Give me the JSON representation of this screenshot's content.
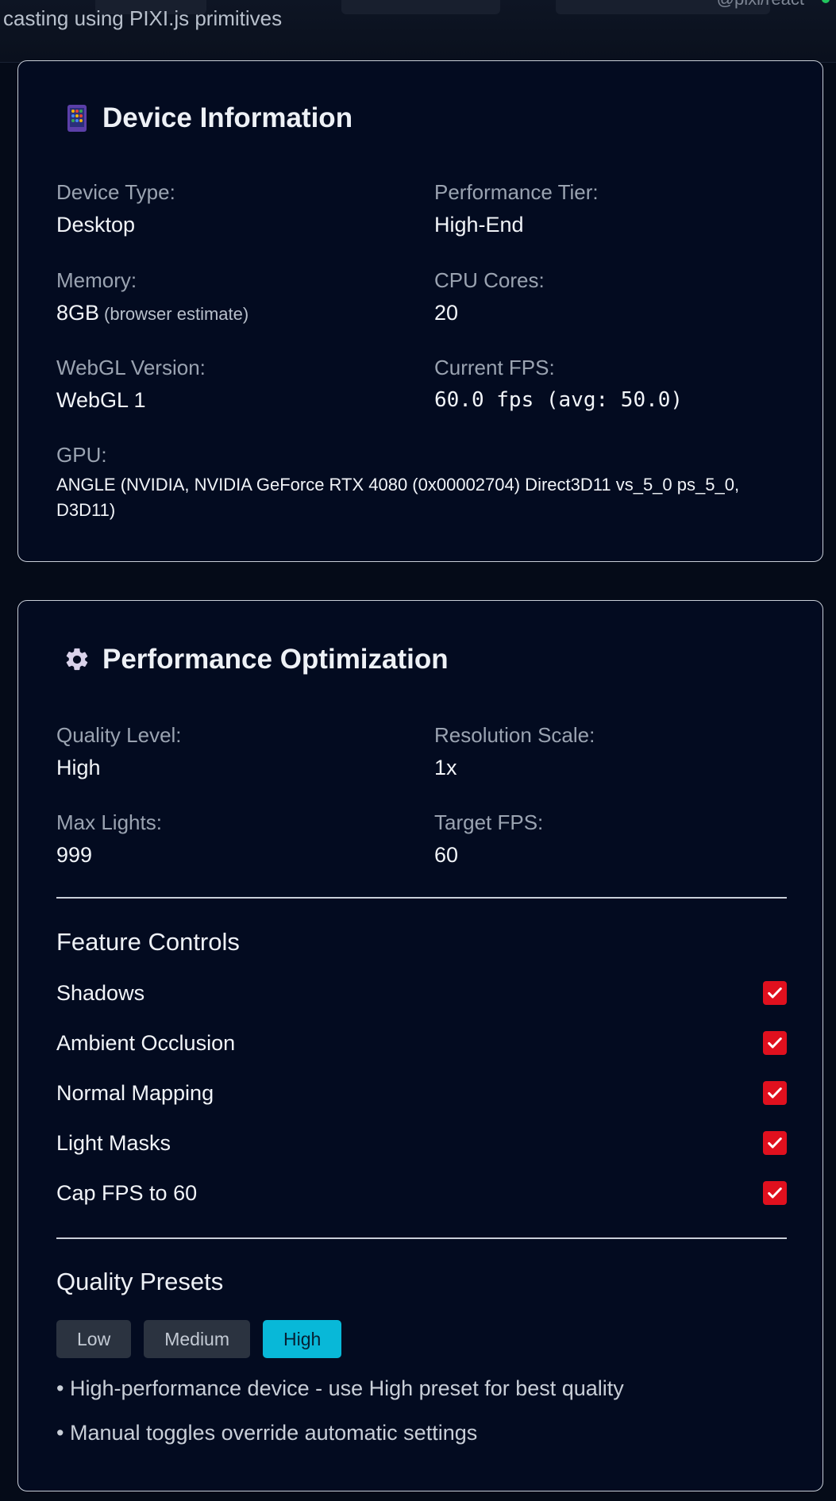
{
  "header": {
    "subtitle": "casting using PIXI.js primitives",
    "handle": "@pixi/react"
  },
  "device_info": {
    "title": "Device Information",
    "icon": "mobile-phone-icon",
    "fields": {
      "device_type": {
        "label": "Device Type:",
        "value": "Desktop"
      },
      "performance_tier": {
        "label": "Performance Tier:",
        "value": "High-End"
      },
      "memory": {
        "label": "Memory:",
        "value": "8GB",
        "note": "(browser estimate)"
      },
      "cpu_cores": {
        "label": "CPU Cores:",
        "value": "20"
      },
      "webgl_version": {
        "label": "WebGL Version:",
        "value": "WebGL 1"
      },
      "current_fps": {
        "label": "Current FPS:",
        "value": "60.0 fps (avg: 50.0)"
      },
      "gpu": {
        "label": "GPU:",
        "value": "ANGLE (NVIDIA, NVIDIA GeForce RTX 4080 (0x00002704) Direct3D11 vs_5_0 ps_5_0, D3D11)"
      }
    }
  },
  "performance": {
    "title": "Performance Optimization",
    "icon": "gear-icon",
    "fields": {
      "quality_level": {
        "label": "Quality Level:",
        "value": "High"
      },
      "resolution_scale": {
        "label": "Resolution Scale:",
        "value": "1x"
      },
      "max_lights": {
        "label": "Max Lights:",
        "value": "999"
      },
      "target_fps": {
        "label": "Target FPS:",
        "value": "60"
      }
    },
    "feature_controls": {
      "heading": "Feature Controls",
      "items": [
        {
          "label": "Shadows",
          "checked": true
        },
        {
          "label": "Ambient Occlusion",
          "checked": true
        },
        {
          "label": "Normal Mapping",
          "checked": true
        },
        {
          "label": "Light Masks",
          "checked": true
        },
        {
          "label": "Cap FPS to 60",
          "checked": true
        }
      ]
    },
    "quality_presets": {
      "heading": "Quality Presets",
      "options": [
        "Low",
        "Medium",
        "High"
      ],
      "selected": "High",
      "accent_color": "#08b8d8"
    },
    "tips": [
      "• High-performance device - use High preset for best quality",
      "• Manual toggles override automatic settings"
    ]
  },
  "colors": {
    "background": "#050b18",
    "card": "#030b20",
    "checkbox": "#e0101e"
  }
}
